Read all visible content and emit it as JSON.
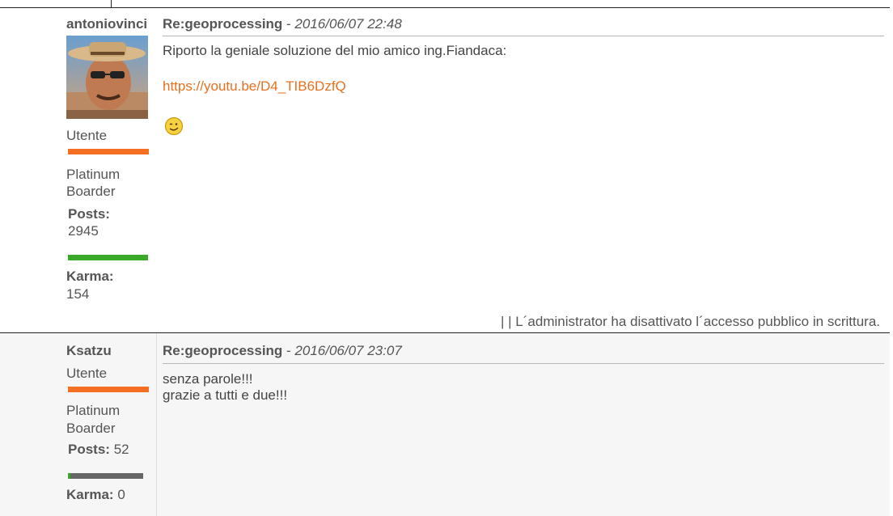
{
  "posts": [
    {
      "author": "antoniovinci",
      "subject": "Re:geoprocessing",
      "separator": " - ",
      "date": "2016/06/07 22:48",
      "rank": "Utente",
      "title_line1": "Platinum",
      "title_line2": "Boarder",
      "posts_label": "Posts:",
      "posts_value": "2945",
      "karma_label": "Karma:",
      "karma_value": "154",
      "body_line1": "Riporto la geniale soluzione del mio amico ing.Fiandaca:",
      "link": "https://youtu.be/D4_TIB6DzfQ",
      "emoticon": "wink-smiley-icon",
      "footer": "| | L´administrator ha disattivato l´accesso pubblico in scrittura."
    },
    {
      "author": "Ksatzu",
      "subject": "Re:geoprocessing",
      "separator": " - ",
      "date": "2016/06/07 23:07",
      "rank": "Utente",
      "title_line1": "Platinum",
      "title_line2": "Boarder",
      "posts_label": "Posts:",
      "posts_value": "52",
      "karma_label": "Karma:",
      "karma_value": "0",
      "body_line1": "senza parole!!!",
      "body_line2": "grazie a tutti e due!!!"
    }
  ],
  "colors": {
    "accent": "#e8701f",
    "rank_bar": "#f46f22",
    "karma_bar": "#3aa829"
  }
}
